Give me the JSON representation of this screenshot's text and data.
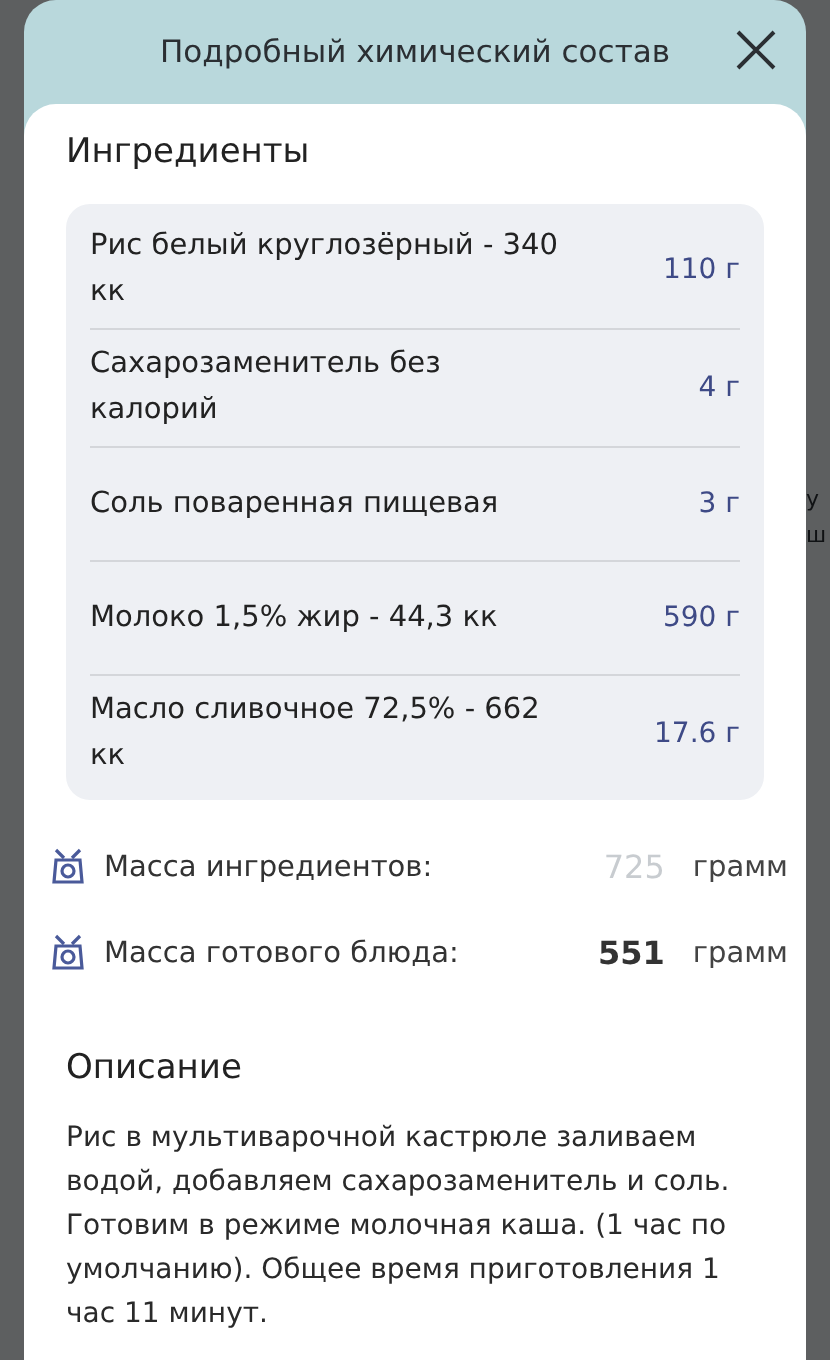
{
  "dialog": {
    "title": "Подробный химический состав"
  },
  "background_fragments": [
    "у",
    "ш"
  ],
  "ingredients": {
    "heading": "Ингредиенты",
    "rows": [
      {
        "name": "Рис белый круглозёрный - 340 кк",
        "amount": "110 г"
      },
      {
        "name": "Сахарозаменитель без калорий",
        "amount": "4 г"
      },
      {
        "name": "Соль поваренная пищевая",
        "amount": "3 г"
      },
      {
        "name": "Молоко 1,5% жир - 44,3 кк",
        "amount": "590 г"
      },
      {
        "name": "Масло сливочное 72,5% - 662 кк",
        "amount": "17.6 г"
      }
    ]
  },
  "masses": [
    {
      "label": "Масса ингредиентов:",
      "value": "725",
      "unit": "грамм",
      "kind": "muted"
    },
    {
      "label": "Масса готового блюда:",
      "value": "551",
      "unit": "грамм",
      "kind": "strong"
    }
  ],
  "description": {
    "heading": "Описание",
    "text": "Рис в мультиварочной кастрюле заливаем водой, добавляем сахарозаменитель и соль. Готовим в режиме молочная каша. (1 час по умолчанию). Общее время приготовления 1 час 11 минут."
  }
}
